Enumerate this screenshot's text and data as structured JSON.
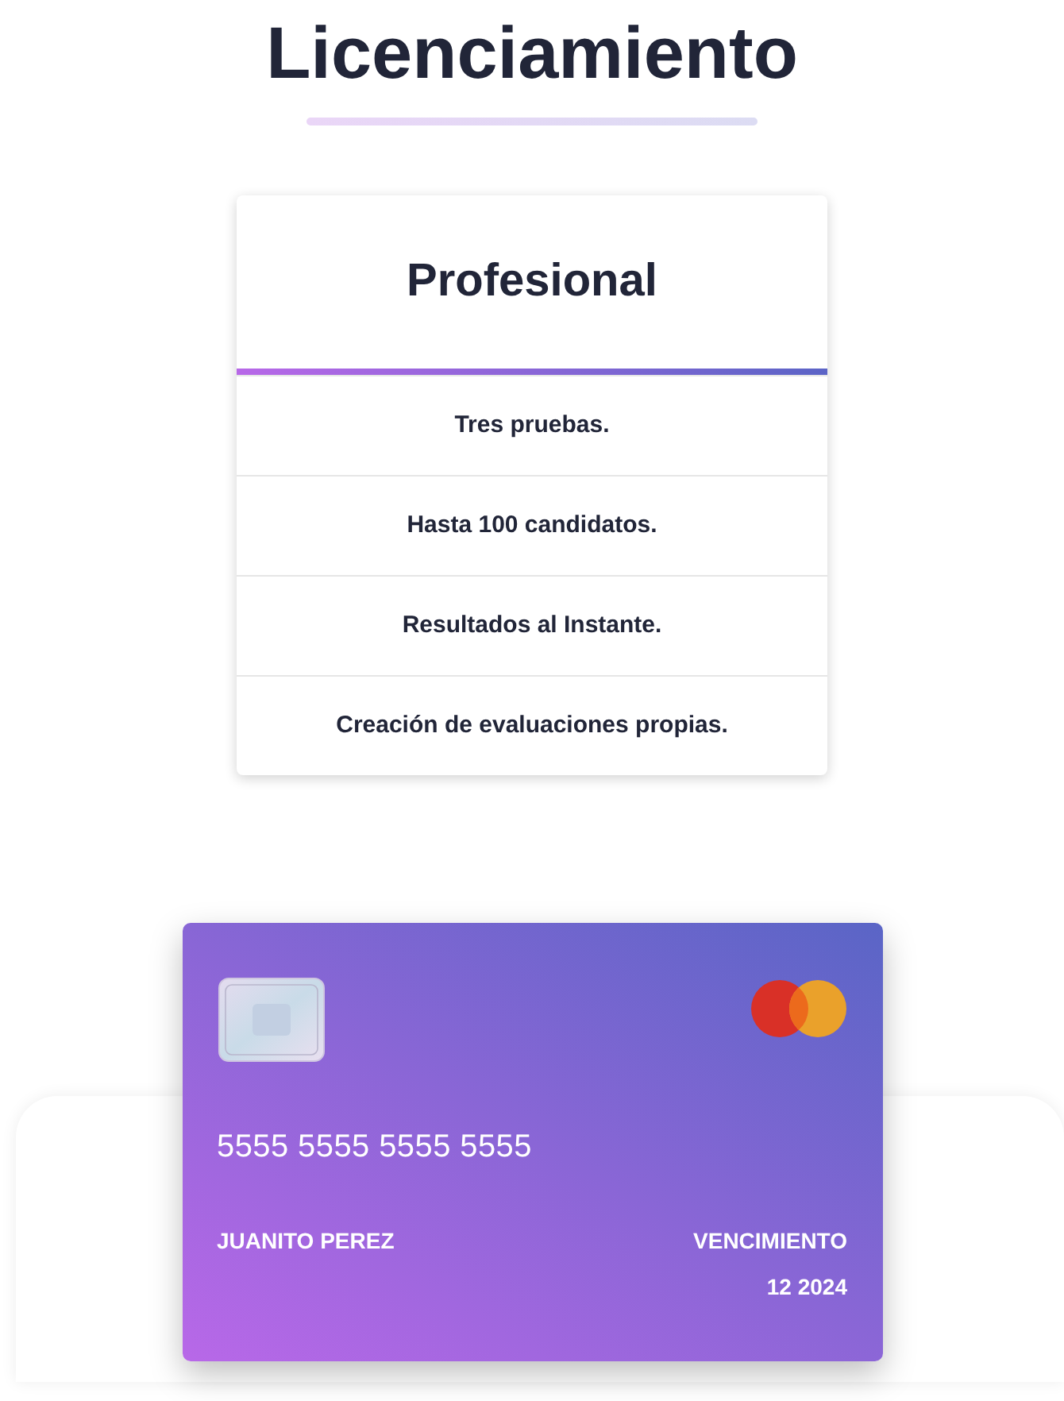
{
  "title": "Licenciamiento",
  "plan": {
    "name": "Profesional",
    "features": [
      "Tres pruebas.",
      "Hasta 100 candidatos.",
      "Resultados al Instante.",
      "Creación de evaluaciones propias."
    ]
  },
  "card": {
    "number": "5555 5555 5555 5555",
    "holder": "JUANITO PEREZ",
    "expiry_label": "VENCIMIENTO",
    "expiry": "12 2024"
  }
}
